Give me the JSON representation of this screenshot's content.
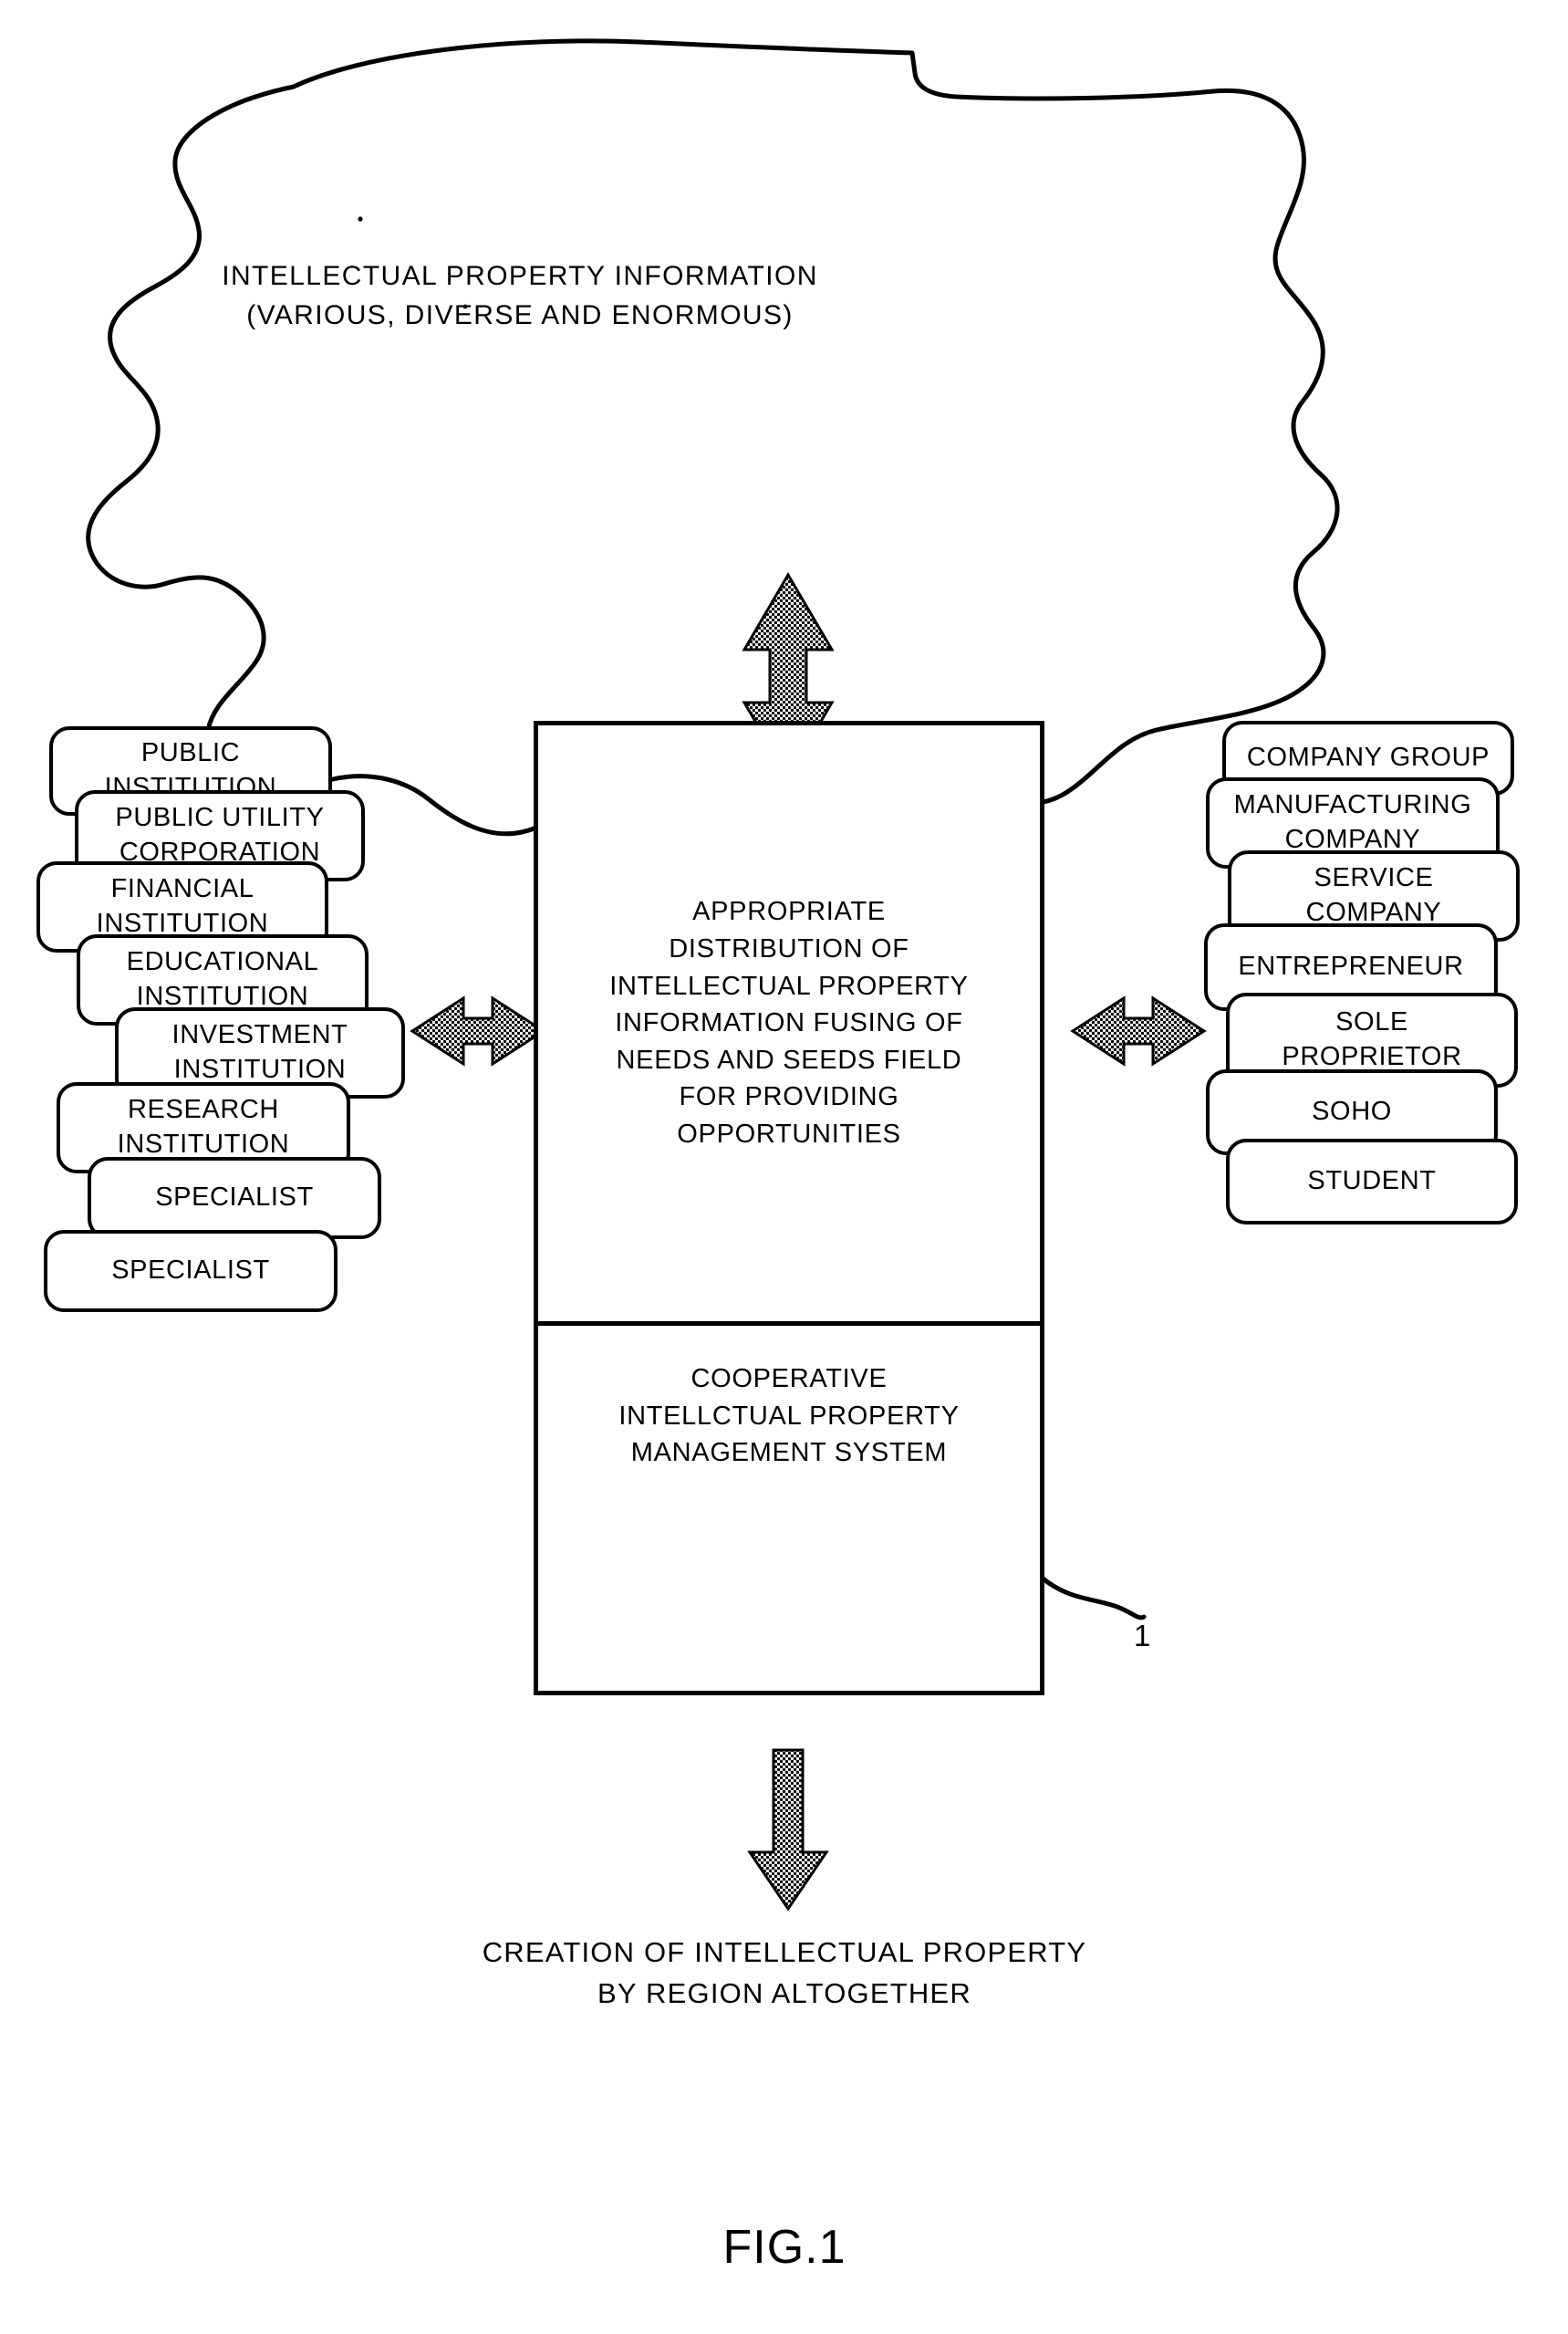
{
  "figure": {
    "label": "FIG.1",
    "reference_numeral": "1"
  },
  "cloud": {
    "name": "intellectual-property-information-cloud",
    "text": "INTELLECTUAL PROPERTY INFORMATION\n(VARIOUS, DIVERSE AND ENORMOUS)"
  },
  "center": {
    "upper_text": "APPROPRIATE\nDISTRIBUTION OF\nINTELLECTUAL PROPERTY\nINFORMATION FUSING OF\nNEEDS AND SEEDS FIELD\nFOR PROVIDING\nOPPORTUNITIES",
    "lower_text": "COOPERATIVE\nINTELLCTUAL PROPERTY\nMANAGEMENT SYSTEM"
  },
  "left_column": {
    "items": [
      {
        "label": "PUBLIC\nINSTITUTION"
      },
      {
        "label": "PUBLIC UTILITY\nCORPORATION"
      },
      {
        "label": "FINANCIAL\nINSTITUTION"
      },
      {
        "label": "EDUCATIONAL\nINSTITUTION"
      },
      {
        "label": "INVESTMENT\nINSTITUTION"
      },
      {
        "label": "RESEARCH\nINSTITUTION"
      },
      {
        "label": "SPECIALIST"
      },
      {
        "label": "SPECIALIST"
      }
    ]
  },
  "right_column": {
    "items": [
      {
        "label": "COMPANY GROUP"
      },
      {
        "label": "MANUFACTURING\nCOMPANY"
      },
      {
        "label": "SERVICE\nCOMPANY"
      },
      {
        "label": "ENTREPRENEUR"
      },
      {
        "label": "SOLE\nPROPRIETOR"
      },
      {
        "label": "SOHO"
      },
      {
        "label": "STUDENT"
      }
    ]
  },
  "bottom_caption": {
    "text": "CREATION OF INTELLECTUAL PROPERTY\nBY REGION ALTOGETHER"
  },
  "arrows": {
    "top": "double-headed-vertical-arrow",
    "left": "double-headed-horizontal-arrow",
    "right": "double-headed-horizontal-arrow",
    "bottom": "down-arrow"
  },
  "colors": {
    "ink": "#000000",
    "paper": "#ffffff",
    "arrow_fill": "#7d7d7d"
  },
  "chart_data": {
    "type": "diagram",
    "title": "FIG.1",
    "nodes": [
      "INTELLECTUAL PROPERTY INFORMATION (VARIOUS, DIVERSE AND ENORMOUS)",
      "APPROPRIATE DISTRIBUTION OF INTELLECTUAL PROPERTY INFORMATION FUSING OF NEEDS AND SEEDS FIELD FOR PROVIDING OPPORTUNITIES",
      "COOPERATIVE INTELLCTUAL PROPERTY MANAGEMENT SYSTEM",
      "PUBLIC INSTITUTION",
      "PUBLIC UTILITY CORPORATION",
      "FINANCIAL INSTITUTION",
      "EDUCATIONAL INSTITUTION",
      "INVESTMENT INSTITUTION",
      "RESEARCH INSTITUTION",
      "SPECIALIST",
      "SPECIALIST",
      "COMPANY GROUP",
      "MANUFACTURING COMPANY",
      "SERVICE COMPANY",
      "ENTREPRENEUR",
      "SOLE PROPRIETOR",
      "SOHO",
      "STUDENT",
      "CREATION OF INTELLECTUAL PROPERTY BY REGION ALTOGETHER"
    ]
  }
}
